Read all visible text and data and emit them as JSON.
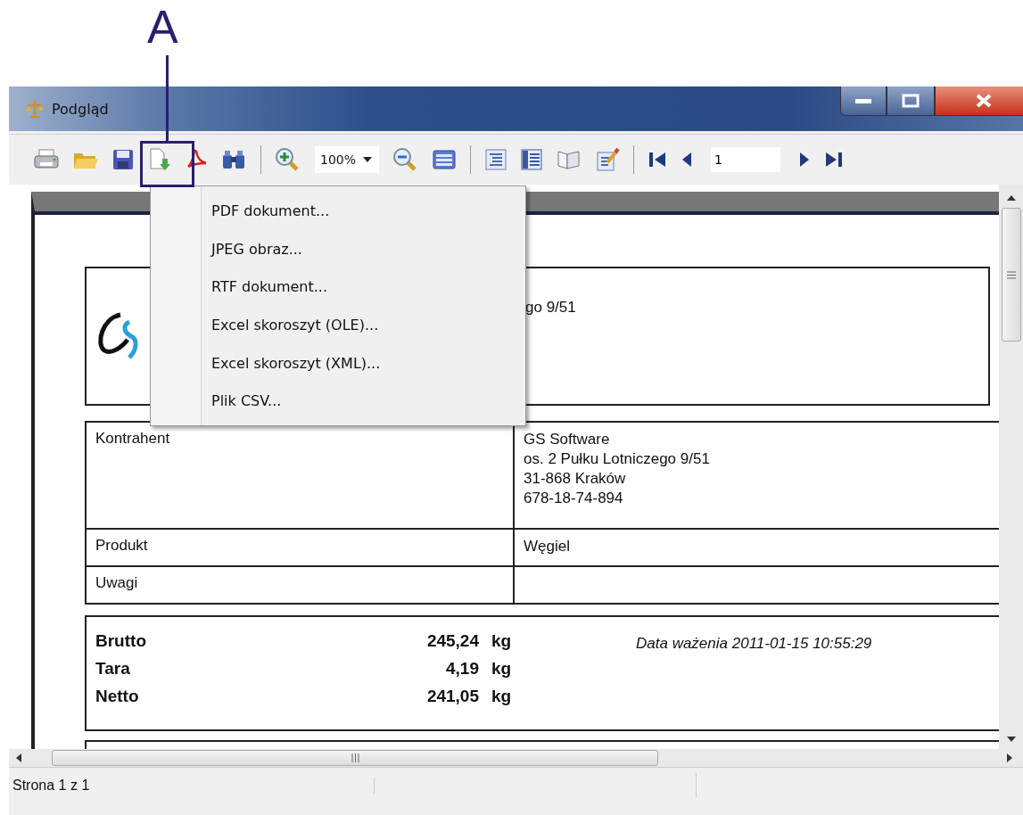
{
  "annotation": {
    "label": "A"
  },
  "window": {
    "title": "Podgląd"
  },
  "toolbar": {
    "zoom": "100%",
    "page": "1"
  },
  "export_menu": {
    "items": [
      {
        "label": "PDF dokument..."
      },
      {
        "label": "JPEG obraz..."
      },
      {
        "label": "RTF dokument..."
      },
      {
        "label": "Excel skoroszyt (OLE)..."
      },
      {
        "label": "Excel skoroszyt (XML)..."
      },
      {
        "label": "Plik CSV..."
      }
    ]
  },
  "document": {
    "header": {
      "text": "go 9/51"
    },
    "details": [
      {
        "label": "Kontrahent",
        "value_lines": [
          "GS Software",
          "os. 2 Pułku Lotniczego 9/51",
          "31-868 Kraków",
          "678-18-74-894"
        ]
      },
      {
        "label": "Produkt",
        "value_lines": [
          "Węgiel"
        ]
      },
      {
        "label": "Uwagi"
      }
    ],
    "weights": [
      {
        "label": "Brutto",
        "value": "245,24",
        "unit": "kg"
      },
      {
        "label": "Tara",
        "value": "4,19",
        "unit": "kg"
      },
      {
        "label": "Netto",
        "value": "241,05",
        "unit": "kg"
      }
    ],
    "weighing_date": "Data ważenia 2011-01-15 10:55:29"
  },
  "status_bar": {
    "text": "Strona 1 z 1"
  }
}
